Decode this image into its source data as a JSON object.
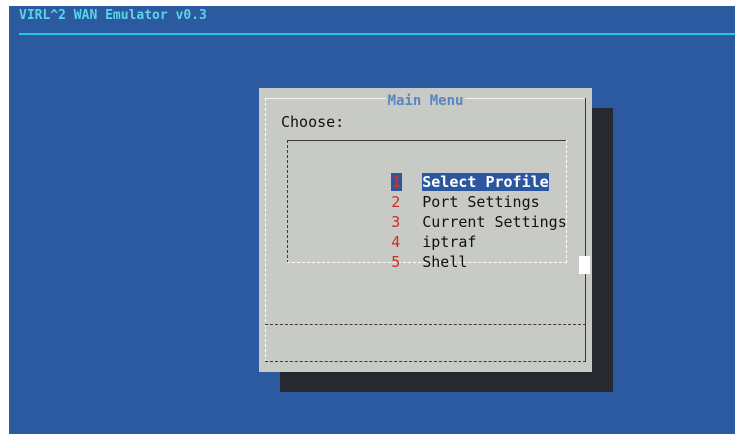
{
  "app": {
    "title": "VIRL^2 WAN Emulator v0.3"
  },
  "dialog": {
    "title": "Main Menu",
    "prompt": "Choose:",
    "items": [
      {
        "key": "1",
        "label": "Select Profile",
        "selected": true
      },
      {
        "key": "2",
        "label": "Port Settings",
        "selected": false
      },
      {
        "key": "3",
        "label": "Current Settings",
        "selected": false
      },
      {
        "key": "4",
        "label": "iptraf",
        "selected": false
      },
      {
        "key": "5",
        "label": "Shell",
        "selected": false
      }
    ]
  },
  "colors": {
    "background": "#2b5aa0",
    "title_text": "#5ad4e6",
    "title_rule": "#22c9e2",
    "dialog_bg": "#c7cac5",
    "dialog_title": "#5a86c0",
    "hotkey": "#c8302a",
    "selection_bg": "#2b56a0",
    "shadow": "#26292d"
  }
}
